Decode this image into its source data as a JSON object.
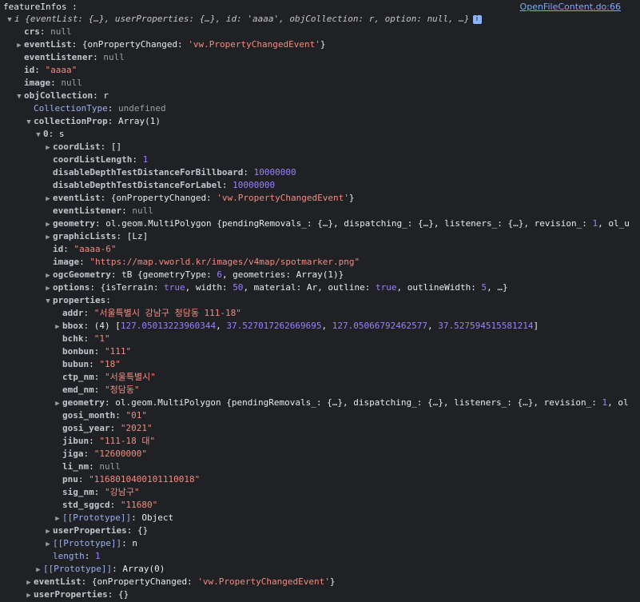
{
  "header": {
    "title": "featureInfos :",
    "source_link": "OpenFileContent.do:66"
  },
  "lines": [
    {
      "i": 0,
      "arrow": "down",
      "segs": [
        {
          "t": "i ",
          "c": "it"
        },
        {
          "t": "{eventList: {…}, userProperties: {…}, id: 'aaaa', objCollection: r, option: null, …}",
          "c": "it"
        }
      ],
      "badge": "i"
    },
    {
      "i": 1,
      "arrow": "none",
      "segs": [
        {
          "t": "crs",
          "c": "kp"
        },
        {
          "t": ": ",
          "c": "pl"
        },
        {
          "t": "null",
          "c": "null"
        }
      ]
    },
    {
      "i": 1,
      "arrow": "right",
      "segs": [
        {
          "t": "eventList",
          "c": "kp"
        },
        {
          "t": ": {onPropertyChanged: ",
          "c": "pl"
        },
        {
          "t": "'vw.PropertyChangedEvent'",
          "c": "s"
        },
        {
          "t": "}",
          "c": "pl"
        }
      ]
    },
    {
      "i": 1,
      "arrow": "none",
      "segs": [
        {
          "t": "eventListener",
          "c": "kp"
        },
        {
          "t": ": ",
          "c": "pl"
        },
        {
          "t": "null",
          "c": "null"
        }
      ]
    },
    {
      "i": 1,
      "arrow": "none",
      "segs": [
        {
          "t": "id",
          "c": "kp"
        },
        {
          "t": ": ",
          "c": "pl"
        },
        {
          "t": "\"aaaa\"",
          "c": "s"
        }
      ]
    },
    {
      "i": 1,
      "arrow": "none",
      "segs": [
        {
          "t": "image",
          "c": "kp"
        },
        {
          "t": ": ",
          "c": "pl"
        },
        {
          "t": "null",
          "c": "null"
        }
      ]
    },
    {
      "i": 1,
      "arrow": "down",
      "segs": [
        {
          "t": "objCollection",
          "c": "kp"
        },
        {
          "t": ": r",
          "c": "pl"
        }
      ]
    },
    {
      "i": 2,
      "arrow": "none",
      "segs": [
        {
          "t": "CollectionType",
          "c": "k"
        },
        {
          "t": ": ",
          "c": "pl"
        },
        {
          "t": "undefined",
          "c": "null"
        }
      ]
    },
    {
      "i": 2,
      "arrow": "down",
      "segs": [
        {
          "t": "collectionProp",
          "c": "kp"
        },
        {
          "t": ": Array(1)",
          "c": "pl"
        }
      ]
    },
    {
      "i": 3,
      "arrow": "down",
      "segs": [
        {
          "t": "0",
          "c": "kp"
        },
        {
          "t": ": s",
          "c": "pl"
        }
      ]
    },
    {
      "i": 4,
      "arrow": "right",
      "segs": [
        {
          "t": "coordList",
          "c": "kp"
        },
        {
          "t": ": []",
          "c": "pl"
        }
      ]
    },
    {
      "i": 4,
      "arrow": "none",
      "segs": [
        {
          "t": "coordListLength",
          "c": "kp"
        },
        {
          "t": ": ",
          "c": "pl"
        },
        {
          "t": "1",
          "c": "n"
        }
      ]
    },
    {
      "i": 4,
      "arrow": "none",
      "segs": [
        {
          "t": "disableDepthTestDistanceForBillboard",
          "c": "kp"
        },
        {
          "t": ": ",
          "c": "pl"
        },
        {
          "t": "10000000",
          "c": "n"
        }
      ]
    },
    {
      "i": 4,
      "arrow": "none",
      "segs": [
        {
          "t": "disableDepthTestDistanceForLabel",
          "c": "kp"
        },
        {
          "t": ": ",
          "c": "pl"
        },
        {
          "t": "10000000",
          "c": "n"
        }
      ]
    },
    {
      "i": 4,
      "arrow": "right",
      "segs": [
        {
          "t": "eventList",
          "c": "kp"
        },
        {
          "t": ": {onPropertyChanged: ",
          "c": "pl"
        },
        {
          "t": "'vw.PropertyChangedEvent'",
          "c": "s"
        },
        {
          "t": "}",
          "c": "pl"
        }
      ]
    },
    {
      "i": 4,
      "arrow": "none",
      "segs": [
        {
          "t": "eventListener",
          "c": "kp"
        },
        {
          "t": ": ",
          "c": "pl"
        },
        {
          "t": "null",
          "c": "null"
        }
      ]
    },
    {
      "i": 4,
      "arrow": "right",
      "segs": [
        {
          "t": "geometry",
          "c": "kp"
        },
        {
          "t": ": ol.geom.MultiPolygon {pendingRemovals_: {…}, dispatching_: {…}, listeners_: {…}, revision_: ",
          "c": "pl"
        },
        {
          "t": "1",
          "c": "n"
        },
        {
          "t": ", ol_u",
          "c": "pl"
        }
      ]
    },
    {
      "i": 4,
      "arrow": "right",
      "segs": [
        {
          "t": "graphicLists",
          "c": "kp"
        },
        {
          "t": ": [Lz]",
          "c": "pl"
        }
      ]
    },
    {
      "i": 4,
      "arrow": "none",
      "segs": [
        {
          "t": "id",
          "c": "kp"
        },
        {
          "t": ": ",
          "c": "pl"
        },
        {
          "t": "\"aaaa-6\"",
          "c": "s"
        }
      ]
    },
    {
      "i": 4,
      "arrow": "none",
      "segs": [
        {
          "t": "image",
          "c": "kp"
        },
        {
          "t": ": ",
          "c": "pl"
        },
        {
          "t": "\"https://map.vworld.kr/images/v4map/spotmarker.png\"",
          "c": "s"
        }
      ]
    },
    {
      "i": 4,
      "arrow": "right",
      "segs": [
        {
          "t": "ogcGeometry",
          "c": "kp"
        },
        {
          "t": ": tB {geometryType: ",
          "c": "pl"
        },
        {
          "t": "6",
          "c": "n"
        },
        {
          "t": ", geometries: Array(1)}",
          "c": "pl"
        }
      ]
    },
    {
      "i": 4,
      "arrow": "right",
      "segs": [
        {
          "t": "options",
          "c": "kp"
        },
        {
          "t": ": {isTerrain: ",
          "c": "pl"
        },
        {
          "t": "true",
          "c": "n"
        },
        {
          "t": ", width: ",
          "c": "pl"
        },
        {
          "t": "50",
          "c": "n"
        },
        {
          "t": ", material: Ar, outline: ",
          "c": "pl"
        },
        {
          "t": "true",
          "c": "n"
        },
        {
          "t": ", outlineWidth: ",
          "c": "pl"
        },
        {
          "t": "5",
          "c": "n"
        },
        {
          "t": ", …}",
          "c": "pl"
        }
      ]
    },
    {
      "i": 4,
      "arrow": "down",
      "segs": [
        {
          "t": "properties",
          "c": "kp"
        },
        {
          "t": ":",
          "c": "pl"
        }
      ]
    },
    {
      "i": 5,
      "arrow": "none",
      "segs": [
        {
          "t": "addr",
          "c": "kp"
        },
        {
          "t": ": ",
          "c": "pl"
        },
        {
          "t": "\"서울특별시 강남구 청담동 111-18\"",
          "c": "s"
        }
      ]
    },
    {
      "i": 5,
      "arrow": "right",
      "segs": [
        {
          "t": "bbox",
          "c": "kp"
        },
        {
          "t": ": (4) [",
          "c": "pl"
        },
        {
          "t": "127.05013223960344",
          "c": "n"
        },
        {
          "t": ", ",
          "c": "pl"
        },
        {
          "t": "37.527017262669695",
          "c": "n"
        },
        {
          "t": ", ",
          "c": "pl"
        },
        {
          "t": "127.05066792462577",
          "c": "n"
        },
        {
          "t": ", ",
          "c": "pl"
        },
        {
          "t": "37.527594515581214",
          "c": "n"
        },
        {
          "t": "]",
          "c": "pl"
        }
      ]
    },
    {
      "i": 5,
      "arrow": "none",
      "segs": [
        {
          "t": "bchk",
          "c": "kp"
        },
        {
          "t": ": ",
          "c": "pl"
        },
        {
          "t": "\"1\"",
          "c": "s"
        }
      ]
    },
    {
      "i": 5,
      "arrow": "none",
      "segs": [
        {
          "t": "bonbun",
          "c": "kp"
        },
        {
          "t": ": ",
          "c": "pl"
        },
        {
          "t": "\"111\"",
          "c": "s"
        }
      ]
    },
    {
      "i": 5,
      "arrow": "none",
      "segs": [
        {
          "t": "bubun",
          "c": "kp"
        },
        {
          "t": ": ",
          "c": "pl"
        },
        {
          "t": "\"18\"",
          "c": "s"
        }
      ]
    },
    {
      "i": 5,
      "arrow": "none",
      "segs": [
        {
          "t": "ctp_nm",
          "c": "kp"
        },
        {
          "t": ": ",
          "c": "pl"
        },
        {
          "t": "\"서울특별시\"",
          "c": "s"
        }
      ]
    },
    {
      "i": 5,
      "arrow": "none",
      "segs": [
        {
          "t": "emd_nm",
          "c": "kp"
        },
        {
          "t": ": ",
          "c": "pl"
        },
        {
          "t": "\"청담동\"",
          "c": "s"
        }
      ]
    },
    {
      "i": 5,
      "arrow": "right",
      "segs": [
        {
          "t": "geometry",
          "c": "kp"
        },
        {
          "t": ": ol.geom.MultiPolygon {pendingRemovals_: {…}, dispatching_: {…}, listeners_: {…}, revision_: ",
          "c": "pl"
        },
        {
          "t": "1",
          "c": "n"
        },
        {
          "t": ", ol",
          "c": "pl"
        }
      ]
    },
    {
      "i": 5,
      "arrow": "none",
      "segs": [
        {
          "t": "gosi_month",
          "c": "kp"
        },
        {
          "t": ": ",
          "c": "pl"
        },
        {
          "t": "\"01\"",
          "c": "s"
        }
      ]
    },
    {
      "i": 5,
      "arrow": "none",
      "segs": [
        {
          "t": "gosi_year",
          "c": "kp"
        },
        {
          "t": ": ",
          "c": "pl"
        },
        {
          "t": "\"2021\"",
          "c": "s"
        }
      ]
    },
    {
      "i": 5,
      "arrow": "none",
      "segs": [
        {
          "t": "jibun",
          "c": "kp"
        },
        {
          "t": ": ",
          "c": "pl"
        },
        {
          "t": "\"111-18 대\"",
          "c": "s"
        }
      ]
    },
    {
      "i": 5,
      "arrow": "none",
      "segs": [
        {
          "t": "jiga",
          "c": "kp"
        },
        {
          "t": ": ",
          "c": "pl"
        },
        {
          "t": "\"12600000\"",
          "c": "s"
        }
      ]
    },
    {
      "i": 5,
      "arrow": "none",
      "segs": [
        {
          "t": "li_nm",
          "c": "kp"
        },
        {
          "t": ": ",
          "c": "pl"
        },
        {
          "t": "null",
          "c": "null"
        }
      ]
    },
    {
      "i": 5,
      "arrow": "none",
      "segs": [
        {
          "t": "pnu",
          "c": "kp"
        },
        {
          "t": ": ",
          "c": "pl"
        },
        {
          "t": "\"1168010400101110018\"",
          "c": "s"
        }
      ]
    },
    {
      "i": 5,
      "arrow": "none",
      "segs": [
        {
          "t": "sig_nm",
          "c": "kp"
        },
        {
          "t": ": ",
          "c": "pl"
        },
        {
          "t": "\"강남구\"",
          "c": "s"
        }
      ]
    },
    {
      "i": 5,
      "arrow": "none",
      "segs": [
        {
          "t": "std_sggcd",
          "c": "kp"
        },
        {
          "t": ": ",
          "c": "pl"
        },
        {
          "t": "\"11680\"",
          "c": "s"
        }
      ]
    },
    {
      "i": 5,
      "arrow": "right",
      "segs": [
        {
          "t": "[[Prototype]]",
          "c": "k"
        },
        {
          "t": ": Object",
          "c": "pl"
        }
      ]
    },
    {
      "i": 4,
      "arrow": "right",
      "segs": [
        {
          "t": "userProperties",
          "c": "kp"
        },
        {
          "t": ": {}",
          "c": "pl"
        }
      ]
    },
    {
      "i": 4,
      "arrow": "right",
      "segs": [
        {
          "t": "[[Prototype]]",
          "c": "k"
        },
        {
          "t": ": n",
          "c": "pl"
        }
      ]
    },
    {
      "i": 4,
      "arrow": "none",
      "segs": [
        {
          "t": "length",
          "c": "k"
        },
        {
          "t": ": ",
          "c": "pl"
        },
        {
          "t": "1",
          "c": "n"
        }
      ]
    },
    {
      "i": 3,
      "arrow": "right",
      "segs": [
        {
          "t": "[[Prototype]]",
          "c": "k"
        },
        {
          "t": ": Array(0)",
          "c": "pl"
        }
      ]
    },
    {
      "i": 2,
      "arrow": "right",
      "segs": [
        {
          "t": "eventList",
          "c": "kp"
        },
        {
          "t": ": {onPropertyChanged: ",
          "c": "pl"
        },
        {
          "t": "'vw.PropertyChangedEvent'",
          "c": "s"
        },
        {
          "t": "}",
          "c": "pl"
        }
      ]
    },
    {
      "i": 2,
      "arrow": "right",
      "segs": [
        {
          "t": "userProperties",
          "c": "kp"
        },
        {
          "t": ": {}",
          "c": "pl"
        }
      ]
    }
  ]
}
